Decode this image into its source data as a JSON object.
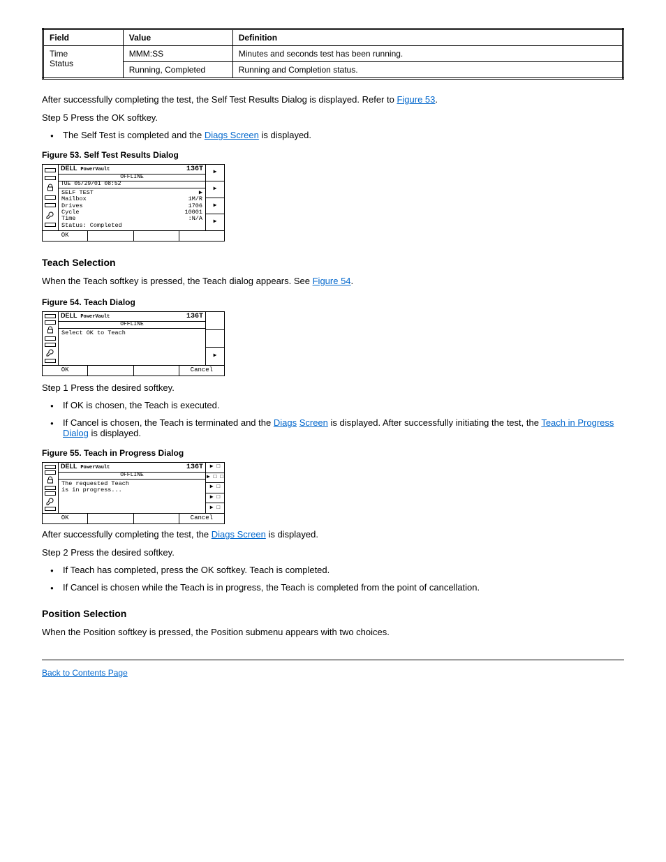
{
  "table": {
    "headers": [
      "Field",
      "Value",
      "Definition"
    ],
    "rows": [
      [
        "Time",
        "MMM:SS",
        "Minutes and seconds test has been running."
      ],
      [
        "Status",
        "Running, Completed",
        "Running and Completion status."
      ]
    ],
    "rowspan_col0": "Time\nStatus"
  },
  "intro": {
    "p1_a": "After successfully completing the test, the Self Test Results Dialog is displayed. Refer to ",
    "p1_link": "Figure 53",
    "p1_b": ".",
    "p2": "Step 5 Press the OK softkey.",
    "bullet_a": "The Self Test is completed and the ",
    "bullet_link": "Diags Screen",
    "bullet_b": " is displayed."
  },
  "fig53": {
    "caption": "Figure 53. Self Test Results Dialog",
    "brand": "DELL",
    "pv": "PowerVault",
    "model": "136T",
    "mode": "OFFLINE",
    "date": "TUE 05/29/01 08:52",
    "title": "SELF TEST",
    "r1": "Mailbox",
    "r2a": "Mailbox",
    "r2b": "1M/R",
    "r3a": "Drives",
    "r3b": "1706",
    "r4a": "Cycle",
    "r4b": "10001",
    "r5a": "Time",
    "r5b": ":N/A",
    "r6": "Status: Completed",
    "btn_ok": "OK"
  },
  "teach": {
    "heading": "Teach Selection",
    "p1a": "When the Teach softkey is pressed, the Teach dialog appears. See ",
    "p1link": "Figure 54",
    "p1b": "."
  },
  "fig54": {
    "caption": "Figure 54. Teach Dialog",
    "brand": "DELL",
    "pv": "PowerVault",
    "model": "136T",
    "mode": "OFFLINE",
    "msg": "Select OK to Teach",
    "btn_ok": "OK",
    "btn_cancel": "Cancel"
  },
  "teach_steps": {
    "p1": "Step 1 Press the desired softkey.",
    "b1a": "If OK is chosen, the Teach is executed.",
    "b2a": "If Cancel is chosen, the Teach is terminated and the ",
    "b2link": "Screen",
    "b2_prelink": "Diags",
    "b2b": " is displayed. After successfully initiating the test, the ",
    "b2link2": "Teach in Progress Dialog",
    "b2c": " is displayed."
  },
  "fig55": {
    "caption": "Figure 55. Teach in Progress Dialog",
    "brand": "DELL",
    "pv": "PowerVault",
    "model": "136T",
    "mode": "OFFLINE",
    "msg1": "The requested Teach",
    "msg2": "is in progress...",
    "btn_ok": "OK",
    "btn_cancel": "Cancel"
  },
  "post55": {
    "p1a": "After successfully completing the test, the ",
    "p1link": "Diags Screen",
    "p1b": " is displayed.",
    "p2": "Step 2 Press the desired softkey.",
    "b1": "If Teach has completed, press the OK softkey. Teach is completed.",
    "b2": "If Cancel is chosen while the Teach is in progress, the Teach is completed from the point of cancellation."
  },
  "pos": {
    "heading": "Position Selection",
    "p1": "When the Position softkey is pressed, the Position submenu appears with two choices."
  },
  "footer": {
    "back": "Back to Contents Page"
  }
}
